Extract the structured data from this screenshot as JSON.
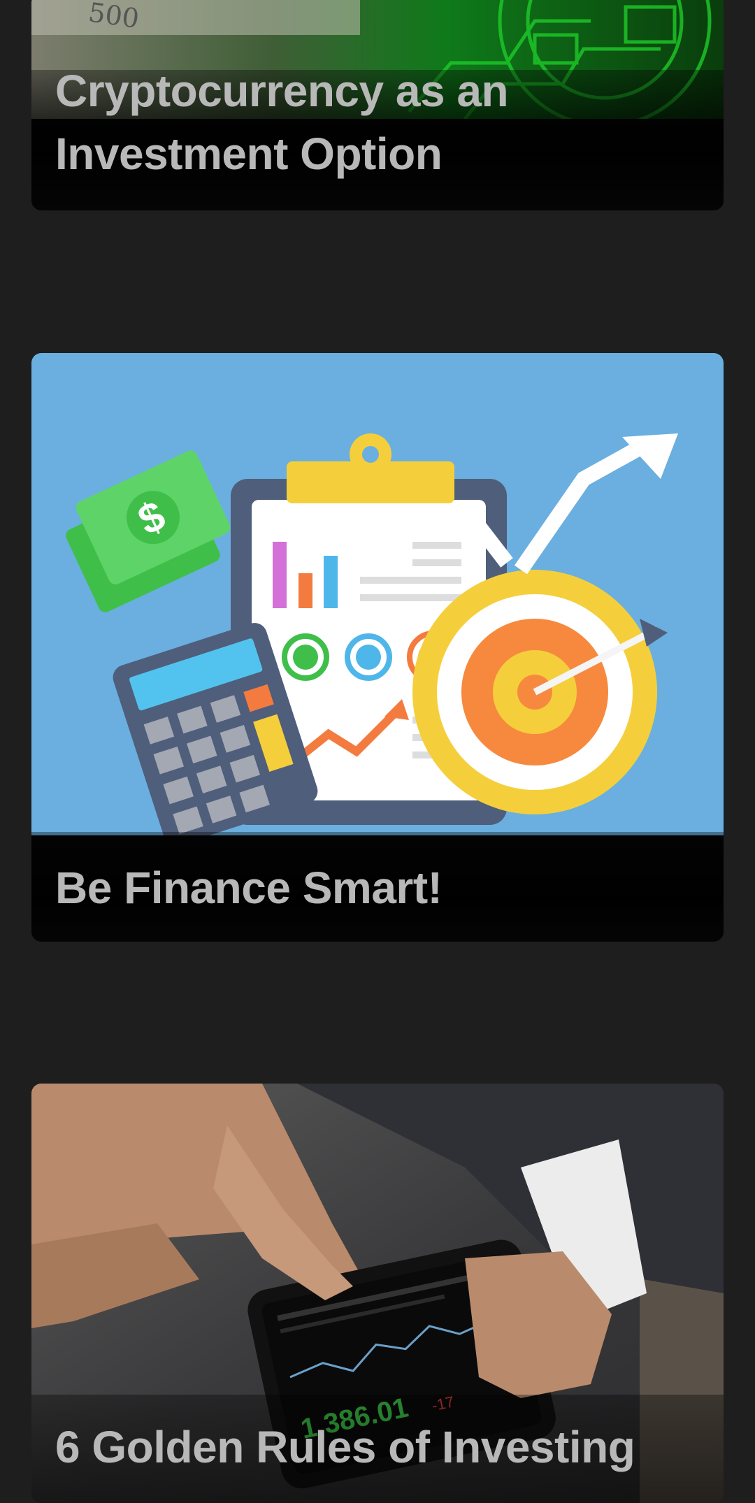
{
  "articles": [
    {
      "title": "Cryptocurrency as an Investment Option",
      "image": "crypto-currency-notes-image"
    },
    {
      "title": "Be Finance Smart!",
      "image": "finance-planning-illustration"
    },
    {
      "title": "6 Golden Rules of Investing",
      "image": "stock-trading-phone-image"
    }
  ],
  "colors": {
    "page_background": "#1e1e1e",
    "title_text": "#b8b8b8",
    "card_caption": "#050505",
    "finance_bg": "#6aafe0"
  }
}
